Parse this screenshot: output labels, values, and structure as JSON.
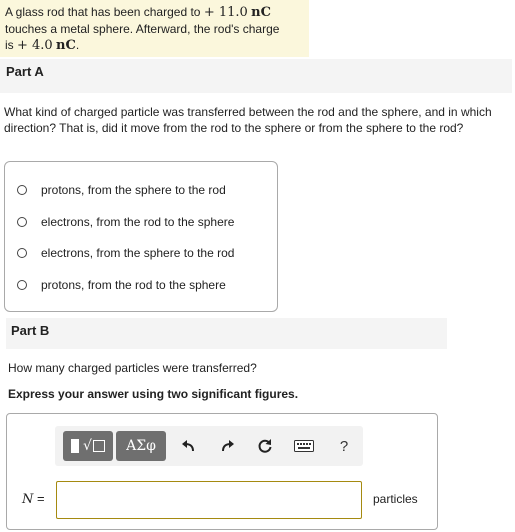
{
  "intro": {
    "text_1": "A glass rod that has been charged to ",
    "charge_initial": "+ 11.0",
    "unit_1": "nC",
    "text_2": "touches a metal sphere. Afterward, the rod's charge",
    "text_3": "is ",
    "charge_final": "+ 4.0",
    "unit_2": "nC",
    "text_4": "."
  },
  "part_a": {
    "label": "Part A",
    "question": "What kind of charged particle was transferred between the rod and the sphere, and in which direction? That is, did it move from the rod to the sphere or from the sphere to the rod?",
    "options": [
      "protons, from the sphere to the rod",
      "electrons, from the rod to the sphere",
      "electrons, from the sphere to the rod",
      "protons, from the rod to the sphere"
    ]
  },
  "part_b": {
    "label": "Part B",
    "question": "How many charged particles were transferred?",
    "instruction": "Express your answer using two significant figures.",
    "toolbar": {
      "greek_label": "ΑΣφ",
      "help_label": "?"
    },
    "variable": "N",
    "equals": "=",
    "input_value": "",
    "units": "particles"
  }
}
